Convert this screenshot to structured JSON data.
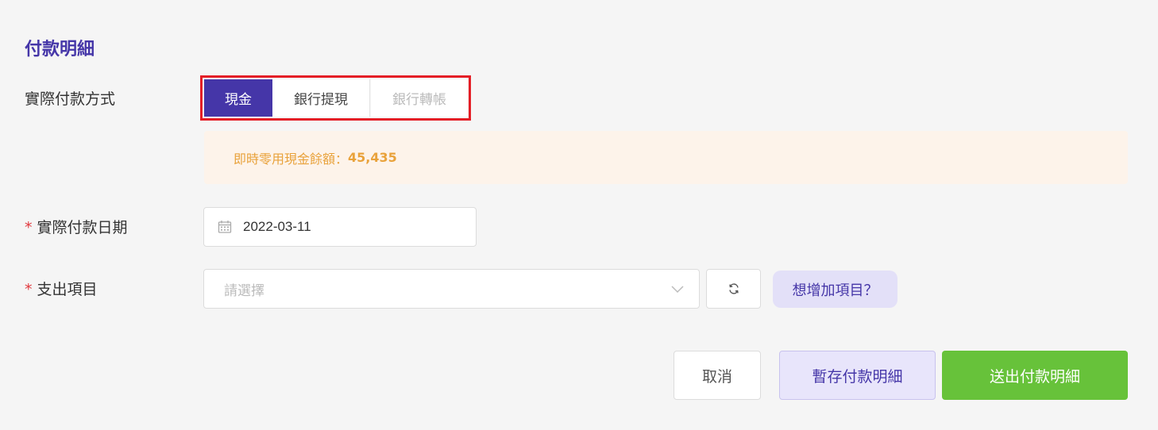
{
  "section": {
    "title": "付款明細"
  },
  "payment_method": {
    "label": "實際付款方式",
    "options": [
      "現金",
      "銀行提現",
      "銀行轉帳"
    ],
    "selected": "現金"
  },
  "cash_notice": {
    "text": "即時零用現金餘額：",
    "amount": "45,435"
  },
  "payment_date": {
    "required_mark": "*",
    "label": "實際付款日期",
    "value": "2022-03-11"
  },
  "expense_item": {
    "required_mark": "*",
    "label": "支出項目",
    "placeholder": "請選擇",
    "add_link": "想增加項目？"
  },
  "actions": {
    "cancel": "取消",
    "draft": "暫存付款明細",
    "submit": "送出付款明細"
  },
  "colors": {
    "primary": "#4536a8",
    "highlight_outline": "#e41e26",
    "notice_text": "#e9a23b",
    "submit": "#67c23a"
  }
}
